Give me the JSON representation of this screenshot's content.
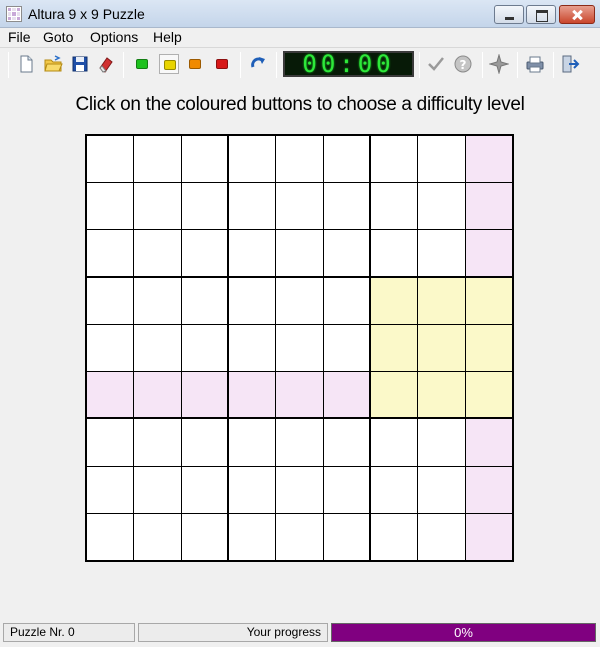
{
  "window": {
    "title": "Altura 9 x 9 Puzzle"
  },
  "menu": [
    "File",
    "Goto",
    "Options",
    "Help"
  ],
  "toolbar": {
    "timer": "00:00",
    "difficulty_colors": {
      "green": "#1ec21e",
      "yellow": "#e8d400",
      "orange": "#f08a00",
      "red": "#d81818"
    }
  },
  "instruction": "Click on the coloured buttons to choose a difficulty level",
  "grid": {
    "highlight_colors": {
      "pink": "#f6e5f6",
      "yellow": "#fbf9c9"
    }
  },
  "status": {
    "puzzle": "Puzzle Nr. 0",
    "progress_label": "Your progress",
    "progress_value": 1.0,
    "progress_text": "0%",
    "progress_color": "#800080"
  }
}
